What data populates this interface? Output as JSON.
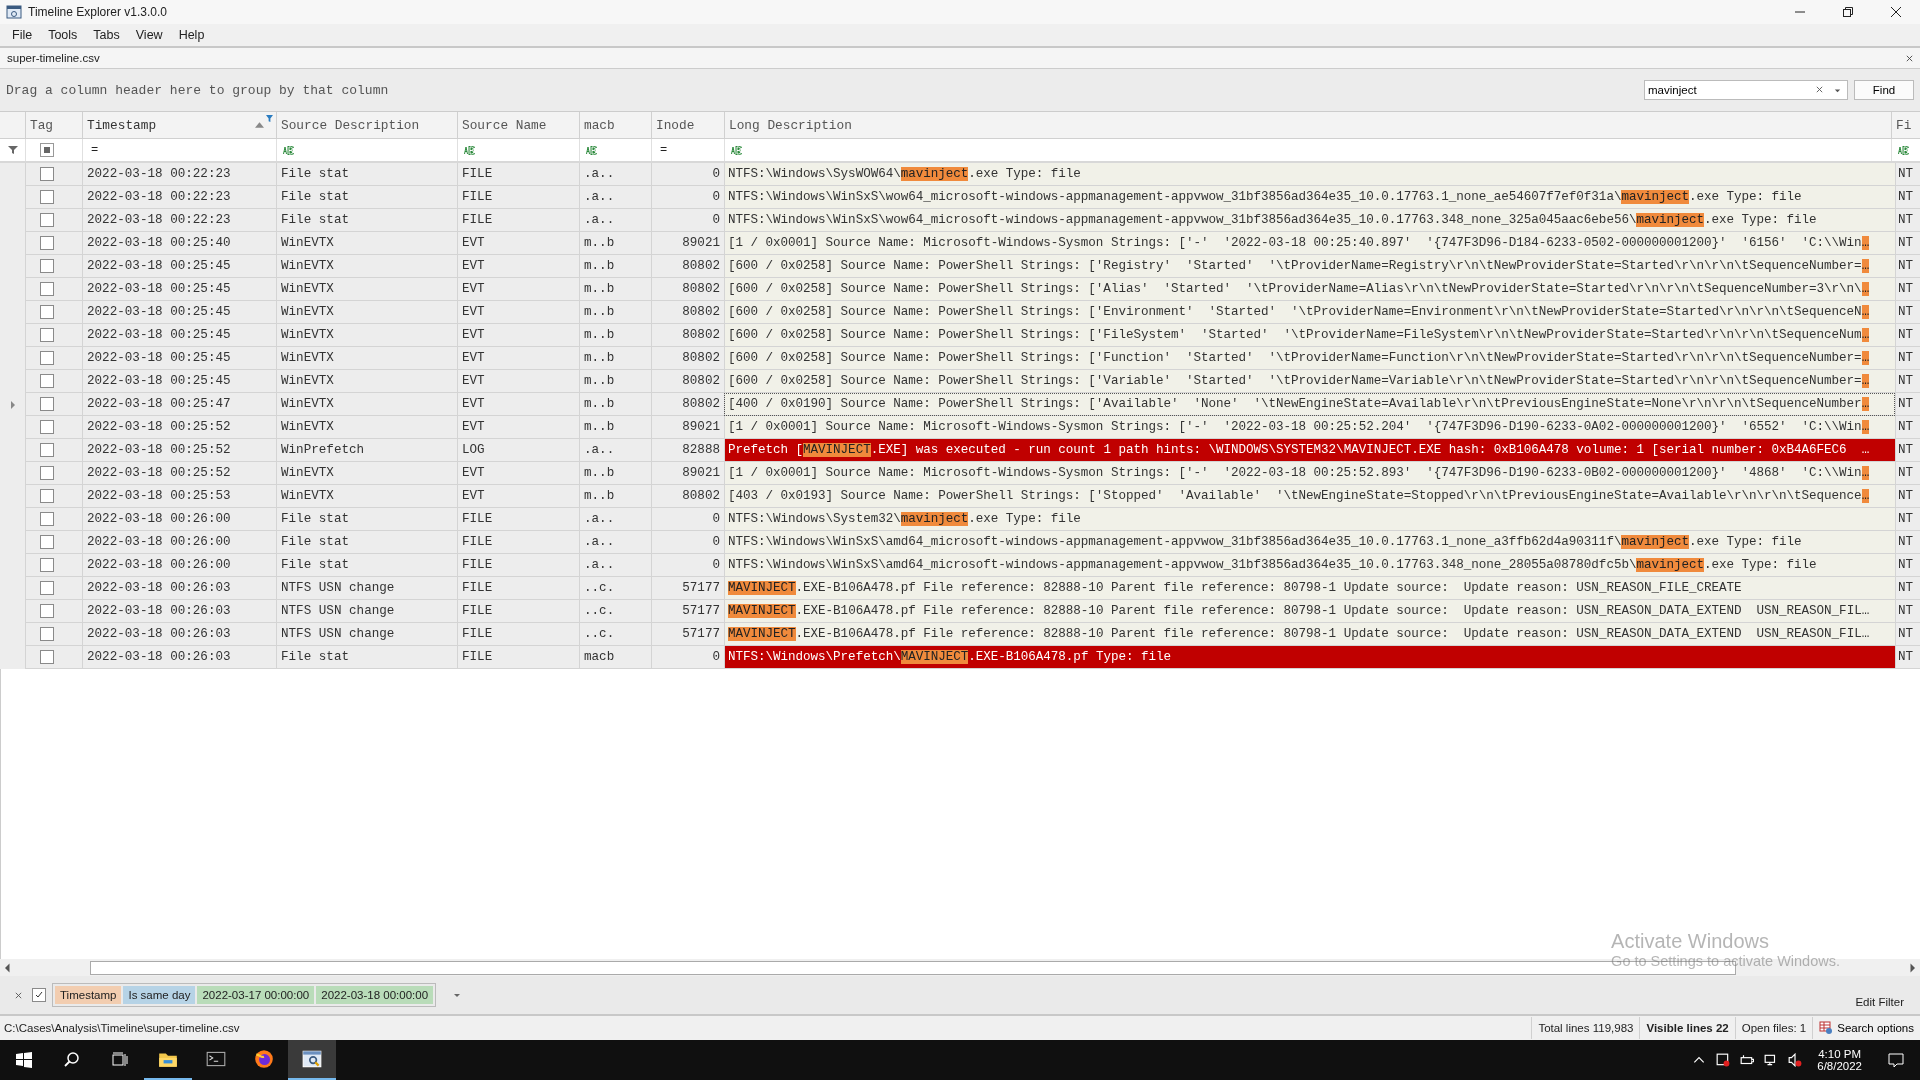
{
  "window": {
    "title": "Timeline Explorer v1.3.0.0"
  },
  "menu": [
    "File",
    "Tools",
    "Tabs",
    "View",
    "Help"
  ],
  "tabs": [
    {
      "label": "super-timeline.csv",
      "selected": true
    }
  ],
  "group_panel": {
    "hint": "Drag a column header here to group by that column"
  },
  "search": {
    "value": "mavinject",
    "button": "Find"
  },
  "columns": [
    {
      "label": "Tag",
      "sorted": false,
      "filtered": false
    },
    {
      "label": "Timestamp",
      "sorted": true,
      "filtered": true
    },
    {
      "label": "Source Description",
      "sorted": false,
      "filtered": false
    },
    {
      "label": "Source Name",
      "sorted": false,
      "filtered": false
    },
    {
      "label": "macb",
      "sorted": false,
      "filtered": false
    },
    {
      "label": "Inode",
      "sorted": false,
      "filtered": false
    },
    {
      "label": "Long Description",
      "sorted": false,
      "filtered": false
    },
    {
      "label": "Fi",
      "sorted": false,
      "filtered": false
    }
  ],
  "filter_row": [
    {
      "kind": "checkbox",
      "indeterminate": true
    },
    {
      "kind": "equals",
      "text": "="
    },
    {
      "kind": "contains"
    },
    {
      "kind": "contains"
    },
    {
      "kind": "contains"
    },
    {
      "kind": "equals",
      "text": "="
    },
    {
      "kind": "contains"
    },
    {
      "kind": "contains"
    }
  ],
  "rows": [
    {
      "checked": false,
      "focused": false,
      "alert": false,
      "ts": "2022-03-18 00:22:23",
      "sd": "File stat",
      "sn": "FILE",
      "macb": ".a..",
      "inode": "0",
      "desc": [
        {
          "text": "NTFS:\\Windows\\SysWOW64\\",
          "hit": false
        },
        {
          "text": "mavinject",
          "hit": true
        },
        {
          "text": ".exe Type: file",
          "hit": false
        }
      ],
      "fi": "NT"
    },
    {
      "checked": false,
      "focused": false,
      "alert": false,
      "ts": "2022-03-18 00:22:23",
      "sd": "File stat",
      "sn": "FILE",
      "macb": ".a..",
      "inode": "0",
      "desc": [
        {
          "text": "NTFS:\\Windows\\WinSxS\\wow64_microsoft-windows-appmanagement-appvwow_31bf3856ad364e35_10.0.17763.1_none_ae54607f7ef0f31a\\",
          "hit": false
        },
        {
          "text": "mavinject",
          "hit": true
        },
        {
          "text": ".exe Type: file",
          "hit": false
        }
      ],
      "fi": "NT"
    },
    {
      "checked": false,
      "focused": false,
      "alert": false,
      "ts": "2022-03-18 00:22:23",
      "sd": "File stat",
      "sn": "FILE",
      "macb": ".a..",
      "inode": "0",
      "desc": [
        {
          "text": "NTFS:\\Windows\\WinSxS\\wow64_microsoft-windows-appmanagement-appvwow_31bf3856ad364e35_10.0.17763.348_none_325a045aac6ebe56\\",
          "hit": false
        },
        {
          "text": "mavinject",
          "hit": true
        },
        {
          "text": ".exe Type: file",
          "hit": false
        }
      ],
      "fi": "NT"
    },
    {
      "checked": false,
      "focused": false,
      "alert": false,
      "ts": "2022-03-18 00:25:40",
      "sd": "WinEVTX",
      "sn": "EVT",
      "macb": "m..b",
      "inode": "89021",
      "desc": [
        {
          "text": "[1 / 0x0001] Source Name: Microsoft-Windows-Sysmon Strings: ['-'  '2022-03-18 00:25:40.897'  '{747F3D96-D184-6233-0502-000000001200}'  '6156'  'C:\\\\Win",
          "hit": false
        },
        {
          "text": "…",
          "hit": true
        }
      ],
      "fi": "NT"
    },
    {
      "checked": false,
      "focused": false,
      "alert": false,
      "ts": "2022-03-18 00:25:45",
      "sd": "WinEVTX",
      "sn": "EVT",
      "macb": "m..b",
      "inode": "80802",
      "desc": [
        {
          "text": "[600 / 0x0258] Source Name: PowerShell Strings: ['Registry'  'Started'  '\\tProviderName=Registry\\r\\n\\tNewProviderState=Started\\r\\n\\r\\n\\tSequenceNumber=",
          "hit": false
        },
        {
          "text": "…",
          "hit": true
        }
      ],
      "fi": "NT"
    },
    {
      "checked": false,
      "focused": false,
      "alert": false,
      "ts": "2022-03-18 00:25:45",
      "sd": "WinEVTX",
      "sn": "EVT",
      "macb": "m..b",
      "inode": "80802",
      "desc": [
        {
          "text": "[600 / 0x0258] Source Name: PowerShell Strings: ['Alias'  'Started'  '\\tProviderName=Alias\\r\\n\\tNewProviderState=Started\\r\\n\\r\\n\\tSequenceNumber=3\\r\\n\\",
          "hit": false
        },
        {
          "text": "…",
          "hit": true
        }
      ],
      "fi": "NT"
    },
    {
      "checked": false,
      "focused": false,
      "alert": false,
      "ts": "2022-03-18 00:25:45",
      "sd": "WinEVTX",
      "sn": "EVT",
      "macb": "m..b",
      "inode": "80802",
      "desc": [
        {
          "text": "[600 / 0x0258] Source Name: PowerShell Strings: ['Environment'  'Started'  '\\tProviderName=Environment\\r\\n\\tNewProviderState=Started\\r\\n\\r\\n\\tSequenceN",
          "hit": false
        },
        {
          "text": "…",
          "hit": true
        }
      ],
      "fi": "NT"
    },
    {
      "checked": false,
      "focused": false,
      "alert": false,
      "ts": "2022-03-18 00:25:45",
      "sd": "WinEVTX",
      "sn": "EVT",
      "macb": "m..b",
      "inode": "80802",
      "desc": [
        {
          "text": "[600 / 0x0258] Source Name: PowerShell Strings: ['FileSystem'  'Started'  '\\tProviderName=FileSystem\\r\\n\\tNewProviderState=Started\\r\\n\\r\\n\\tSequenceNum",
          "hit": false
        },
        {
          "text": "…",
          "hit": true
        }
      ],
      "fi": "NT"
    },
    {
      "checked": false,
      "focused": false,
      "alert": false,
      "ts": "2022-03-18 00:25:45",
      "sd": "WinEVTX",
      "sn": "EVT",
      "macb": "m..b",
      "inode": "80802",
      "desc": [
        {
          "text": "[600 / 0x0258] Source Name: PowerShell Strings: ['Function'  'Started'  '\\tProviderName=Function\\r\\n\\tNewProviderState=Started\\r\\n\\r\\n\\tSequenceNumber=",
          "hit": false
        },
        {
          "text": "…",
          "hit": true
        }
      ],
      "fi": "NT"
    },
    {
      "checked": false,
      "focused": false,
      "alert": false,
      "ts": "2022-03-18 00:25:45",
      "sd": "WinEVTX",
      "sn": "EVT",
      "macb": "m..b",
      "inode": "80802",
      "desc": [
        {
          "text": "[600 / 0x0258] Source Name: PowerShell Strings: ['Variable'  'Started'  '\\tProviderName=Variable\\r\\n\\tNewProviderState=Started\\r\\n\\r\\n\\tSequenceNumber=",
          "hit": false
        },
        {
          "text": "…",
          "hit": true
        }
      ],
      "fi": "NT"
    },
    {
      "checked": false,
      "focused": true,
      "alert": false,
      "ts": "2022-03-18 00:25:47",
      "sd": "WinEVTX",
      "sn": "EVT",
      "macb": "m..b",
      "inode": "80802",
      "desc": [
        {
          "text": "[400 / 0x0190] Source Name: PowerShell Strings: ['Available'  'None'  '\\tNewEngineState=Available\\r\\n\\tPreviousEngineState=None\\r\\n\\r\\n\\tSequenceNumber",
          "hit": false
        },
        {
          "text": "…",
          "hit": true
        }
      ],
      "fi": "NT"
    },
    {
      "checked": false,
      "focused": false,
      "alert": false,
      "ts": "2022-03-18 00:25:52",
      "sd": "WinEVTX",
      "sn": "EVT",
      "macb": "m..b",
      "inode": "89021",
      "desc": [
        {
          "text": "[1 / 0x0001] Source Name: Microsoft-Windows-Sysmon Strings: ['-'  '2022-03-18 00:25:52.204'  '{747F3D96-D190-6233-0A02-000000001200}'  '6552'  'C:\\\\Win",
          "hit": false
        },
        {
          "text": "…",
          "hit": true
        }
      ],
      "fi": "NT"
    },
    {
      "checked": false,
      "focused": false,
      "alert": true,
      "ts": "2022-03-18 00:25:52",
      "sd": "WinPrefetch",
      "sn": "LOG",
      "macb": ".a..",
      "inode": "82888",
      "desc": [
        {
          "text": "Prefetch [",
          "hit": false
        },
        {
          "text": "MAVINJECT",
          "hit": true
        },
        {
          "text": ".EXE] was executed - run count 1 path hints: \\WINDOWS\\SYSTEM32\\MAVINJECT.EXE hash: 0xB106A478 volume: 1 [serial number: 0xB4A6FEC6  …",
          "hit": false
        }
      ],
      "fi": "NT"
    },
    {
      "checked": false,
      "focused": false,
      "alert": false,
      "ts": "2022-03-18 00:25:52",
      "sd": "WinEVTX",
      "sn": "EVT",
      "macb": "m..b",
      "inode": "89021",
      "desc": [
        {
          "text": "[1 / 0x0001] Source Name: Microsoft-Windows-Sysmon Strings: ['-'  '2022-03-18 00:25:52.893'  '{747F3D96-D190-6233-0B02-000000001200}'  '4868'  'C:\\\\Win",
          "hit": false
        },
        {
          "text": "…",
          "hit": true
        }
      ],
      "fi": "NT"
    },
    {
      "checked": false,
      "focused": false,
      "alert": false,
      "ts": "2022-03-18 00:25:53",
      "sd": "WinEVTX",
      "sn": "EVT",
      "macb": "m..b",
      "inode": "80802",
      "desc": [
        {
          "text": "[403 / 0x0193] Source Name: PowerShell Strings: ['Stopped'  'Available'  '\\tNewEngineState=Stopped\\r\\n\\tPreviousEngineState=Available\\r\\n\\r\\n\\tSequence",
          "hit": false
        },
        {
          "text": "…",
          "hit": true
        }
      ],
      "fi": "NT"
    },
    {
      "checked": false,
      "focused": false,
      "alert": false,
      "ts": "2022-03-18 00:26:00",
      "sd": "File stat",
      "sn": "FILE",
      "macb": ".a..",
      "inode": "0",
      "desc": [
        {
          "text": "NTFS:\\Windows\\System32\\",
          "hit": false
        },
        {
          "text": "mavinject",
          "hit": true
        },
        {
          "text": ".exe Type: file",
          "hit": false
        }
      ],
      "fi": "NT"
    },
    {
      "checked": false,
      "focused": false,
      "alert": false,
      "ts": "2022-03-18 00:26:00",
      "sd": "File stat",
      "sn": "FILE",
      "macb": ".a..",
      "inode": "0",
      "desc": [
        {
          "text": "NTFS:\\Windows\\WinSxS\\amd64_microsoft-windows-appmanagement-appvwow_31bf3856ad364e35_10.0.17763.1_none_a3ffb62d4a90311f\\",
          "hit": false
        },
        {
          "text": "mavinject",
          "hit": true
        },
        {
          "text": ".exe Type: file",
          "hit": false
        }
      ],
      "fi": "NT"
    },
    {
      "checked": false,
      "focused": false,
      "alert": false,
      "ts": "2022-03-18 00:26:00",
      "sd": "File stat",
      "sn": "FILE",
      "macb": ".a..",
      "inode": "0",
      "desc": [
        {
          "text": "NTFS:\\Windows\\WinSxS\\amd64_microsoft-windows-appmanagement-appvwow_31bf3856ad364e35_10.0.17763.348_none_28055a08780dfc5b\\",
          "hit": false
        },
        {
          "text": "mavinject",
          "hit": true
        },
        {
          "text": ".exe Type: file",
          "hit": false
        }
      ],
      "fi": "NT"
    },
    {
      "checked": false,
      "focused": false,
      "alert": false,
      "ts": "2022-03-18 00:26:03",
      "sd": "NTFS USN change",
      "sn": "FILE",
      "macb": "..c.",
      "inode": "57177",
      "desc": [
        {
          "text": "MAVINJECT",
          "hit": true
        },
        {
          "text": ".EXE-B106A478.pf File reference: 82888-10 Parent file reference: 80798-1 Update source:  Update reason: USN_REASON_FILE_CREATE",
          "hit": false
        }
      ],
      "fi": "NT"
    },
    {
      "checked": false,
      "focused": false,
      "alert": false,
      "ts": "2022-03-18 00:26:03",
      "sd": "NTFS USN change",
      "sn": "FILE",
      "macb": "..c.",
      "inode": "57177",
      "desc": [
        {
          "text": "MAVINJECT",
          "hit": true
        },
        {
          "text": ".EXE-B106A478.pf File reference: 82888-10 Parent file reference: 80798-1 Update source:  Update reason: USN_REASON_DATA_EXTEND  USN_REASON_FIL…",
          "hit": false
        }
      ],
      "fi": "NT"
    },
    {
      "checked": false,
      "focused": false,
      "alert": false,
      "ts": "2022-03-18 00:26:03",
      "sd": "NTFS USN change",
      "sn": "FILE",
      "macb": "..c.",
      "inode": "57177",
      "desc": [
        {
          "text": "MAVINJECT",
          "hit": true
        },
        {
          "text": ".EXE-B106A478.pf File reference: 82888-10 Parent file reference: 80798-1 Update source:  Update reason: USN_REASON_DATA_EXTEND  USN_REASON_FIL…",
          "hit": false
        }
      ],
      "fi": "NT"
    },
    {
      "checked": false,
      "focused": false,
      "alert": true,
      "ts": "2022-03-18 00:26:03",
      "sd": "File stat",
      "sn": "FILE",
      "macb": "macb",
      "inode": "0",
      "desc": [
        {
          "text": "NTFS:\\Windows\\Prefetch\\",
          "hit": false
        },
        {
          "text": "MAVINJECT",
          "hit": true
        },
        {
          "text": ".EXE-B106A478.pf Type: file",
          "hit": false
        }
      ],
      "fi": "NT"
    }
  ],
  "filter_bar": {
    "enabled": true,
    "chips": [
      {
        "text": "Timestamp",
        "color": "#f2cdb0"
      },
      {
        "text": "Is same day",
        "color": "#b6d3e6"
      },
      {
        "text": "2022-03-17 00:00:00",
        "color": "#b9dcb9"
      },
      {
        "text": "2022-03-18 00:00:00",
        "color": "#b9dcb9"
      }
    ],
    "edit": "Edit Filter"
  },
  "os_watermark": {
    "title": "Activate Windows",
    "subtitle": "Go to Settings to activate Windows."
  },
  "status_bar": {
    "path": "C:\\Cases\\Analysis\\Timeline\\super-timeline.csv",
    "total": "Total lines 119,983",
    "visible": "Visible lines 22",
    "open": "Open files: 1",
    "search_options": "Search options"
  },
  "taskbar": {
    "apps": [
      {
        "kind": "explorer",
        "running": true,
        "selected": false
      },
      {
        "kind": "terminal",
        "running": false,
        "selected": false
      },
      {
        "kind": "browser",
        "running": false,
        "selected": false
      },
      {
        "kind": "timeline",
        "running": true,
        "selected": true
      }
    ],
    "time": "4:10 PM",
    "date": "6/8/2022"
  }
}
